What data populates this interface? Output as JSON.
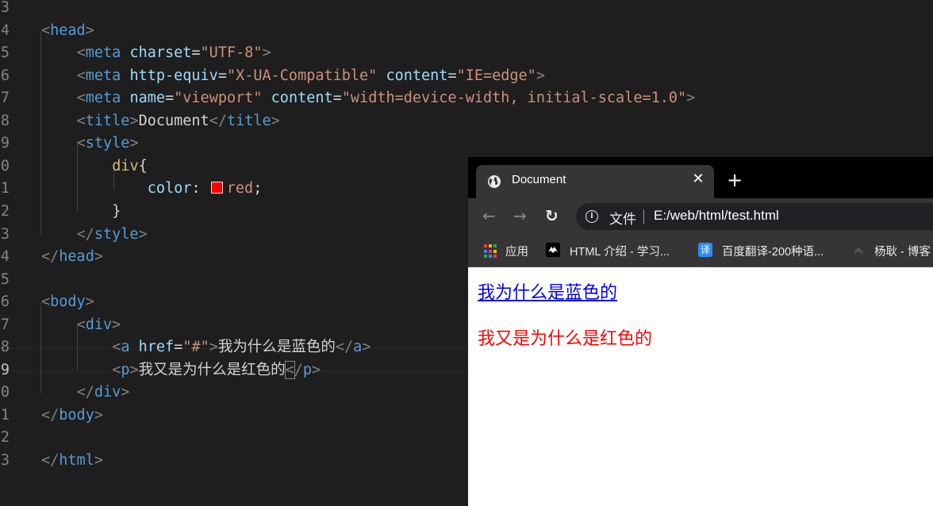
{
  "editor": {
    "line_numbers": [
      "3",
      "4",
      "5",
      "6",
      "7",
      "8",
      "9",
      "0",
      "1",
      "2",
      "3",
      "4",
      "5",
      "6",
      "7",
      "8",
      "9",
      "0",
      "1",
      "2",
      "3"
    ],
    "lines": [
      [],
      [
        [
          "t-punct",
          "<"
        ],
        [
          "t-tag",
          "head"
        ],
        [
          "t-punct",
          ">"
        ]
      ],
      [
        [
          "t-punct",
          "<"
        ],
        [
          "t-tag",
          "meta "
        ],
        [
          "t-attr",
          "charset"
        ],
        [
          "t-text",
          "="
        ],
        [
          "t-str",
          "\"UTF-8\""
        ],
        [
          "t-punct",
          ">"
        ]
      ],
      [
        [
          "t-punct",
          "<"
        ],
        [
          "t-tag",
          "meta "
        ],
        [
          "t-attr",
          "http-equiv"
        ],
        [
          "t-text",
          "="
        ],
        [
          "t-str",
          "\"X-UA-Compatible\""
        ],
        [
          "t-text",
          " "
        ],
        [
          "t-attr",
          "content"
        ],
        [
          "t-text",
          "="
        ],
        [
          "t-str",
          "\"IE=edge\""
        ],
        [
          "t-punct",
          ">"
        ]
      ],
      [
        [
          "t-punct",
          "<"
        ],
        [
          "t-tag",
          "meta "
        ],
        [
          "t-attr",
          "name"
        ],
        [
          "t-text",
          "="
        ],
        [
          "t-str",
          "\"viewport\""
        ],
        [
          "t-text",
          " "
        ],
        [
          "t-attr",
          "content"
        ],
        [
          "t-text",
          "="
        ],
        [
          "t-str",
          "\"width=device-width, initial-scale=1.0\""
        ],
        [
          "t-punct",
          ">"
        ]
      ],
      [
        [
          "t-punct",
          "<"
        ],
        [
          "t-tag",
          "title"
        ],
        [
          "t-punct",
          ">"
        ],
        [
          "t-text",
          "Document"
        ],
        [
          "t-punct",
          "</"
        ],
        [
          "t-tag",
          "title"
        ],
        [
          "t-punct",
          ">"
        ]
      ],
      [
        [
          "t-punct",
          "<"
        ],
        [
          "t-tag",
          "style"
        ],
        [
          "t-punct",
          ">"
        ]
      ],
      [
        [
          "t-sel",
          "div"
        ],
        [
          "t-text",
          "{"
        ]
      ],
      [
        [
          "t-prop",
          "color"
        ],
        [
          "t-text",
          ": "
        ],
        [
          "swatch",
          "#ff0000"
        ],
        [
          "t-val",
          "red"
        ],
        [
          "t-text",
          ";"
        ]
      ],
      [
        [
          "t-text",
          "}"
        ]
      ],
      [
        [
          "t-punct",
          "</"
        ],
        [
          "t-tag",
          "style"
        ],
        [
          "t-punct",
          ">"
        ]
      ],
      [
        [
          "t-punct",
          "</"
        ],
        [
          "t-tag",
          "head"
        ],
        [
          "t-punct",
          ">"
        ]
      ],
      [],
      [
        [
          "t-punct",
          "<"
        ],
        [
          "t-tag",
          "body"
        ],
        [
          "t-punct",
          ">"
        ]
      ],
      [
        [
          "t-punct",
          "<"
        ],
        [
          "t-tag",
          "div"
        ],
        [
          "t-punct",
          ">"
        ]
      ],
      [
        [
          "t-punct",
          "<"
        ],
        [
          "t-tag",
          "a "
        ],
        [
          "t-attr",
          "href"
        ],
        [
          "t-text",
          "="
        ],
        [
          "t-str",
          "\"#\""
        ],
        [
          "t-punct",
          ">"
        ],
        [
          "t-text",
          "我为什么是蓝色的"
        ],
        [
          "t-punct",
          "</"
        ],
        [
          "t-tag",
          "a"
        ],
        [
          "t-punct",
          ">"
        ]
      ],
      [
        [
          "t-punct",
          "<"
        ],
        [
          "t-tag",
          "p"
        ],
        [
          "t-punct",
          ">"
        ],
        [
          "t-text",
          "我又是为什么是红色的"
        ],
        [
          "t-punct",
          "<"
        ],
        [
          "t-punct",
          "/"
        ],
        [
          "t-tag",
          "p"
        ],
        [
          "t-punct",
          ">"
        ]
      ],
      [
        [
          "t-punct",
          "</"
        ],
        [
          "t-tag",
          "div"
        ],
        [
          "t-punct",
          ">"
        ]
      ],
      [
        [
          "t-punct",
          "</"
        ],
        [
          "t-tag",
          "body"
        ],
        [
          "t-punct",
          ">"
        ]
      ],
      [],
      [
        [
          "t-punct",
          "</"
        ],
        [
          "t-tag",
          "html"
        ],
        [
          "t-punct",
          ">"
        ]
      ]
    ]
  },
  "browser": {
    "tab_title": "Document",
    "tab_close": "✕",
    "new_tab": "+",
    "back": "←",
    "forward": "→",
    "reload": "↻",
    "info_icon": "i",
    "omnibox_label": "文件",
    "url": "E:/web/html/test.html",
    "bookmarks": [
      {
        "label": "应用",
        "icon": "apps-grid-icon"
      },
      {
        "label": "HTML 介绍 - 学习...",
        "icon": "mdn-icon"
      },
      {
        "label": "百度翻译-200种语...",
        "icon": "translate-icon"
      },
      {
        "label": "杨耿 - 博客",
        "icon": "blog-icon"
      }
    ],
    "page": {
      "link_text": "我为什么是蓝色的",
      "paragraph_text": "我又是为什么是红色的"
    }
  },
  "colors": {
    "link": "#0000ee",
    "paragraph": "#ff0000",
    "editor_bg": "#1e1e1e"
  }
}
